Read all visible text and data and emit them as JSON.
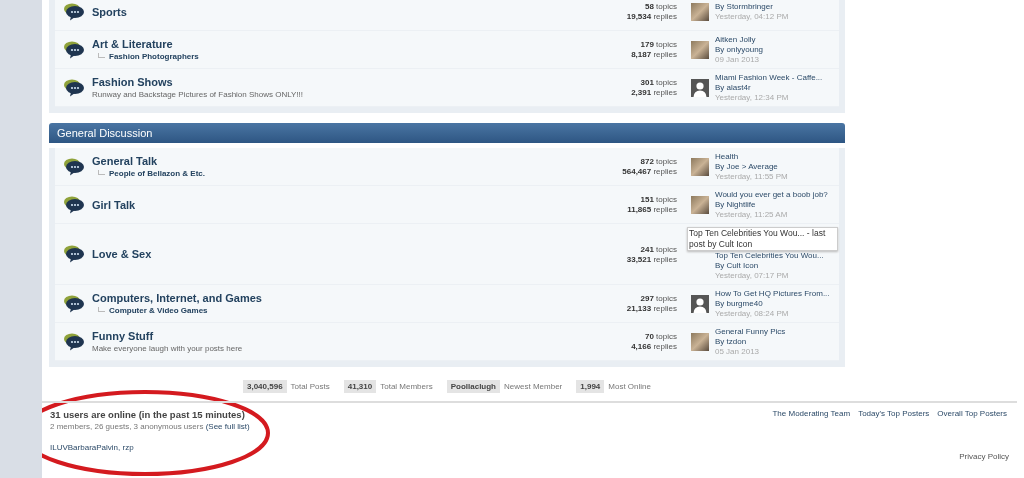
{
  "sections": [
    {
      "forums": [
        {
          "name": "Sports",
          "topics": "**58** topics",
          "replies": "**19,534** replies",
          "last_post": {
            "by": "By Stormbringer",
            "date": "Yesterday, 04:12 PM",
            "kind": "photo"
          }
        },
        {
          "name": "Art & Literature",
          "subforums": [
            "Fashion Photographers"
          ],
          "topics": "**179** topics",
          "replies": "**8,187** replies",
          "last_post": {
            "title": "Aitken Jolly",
            "by": "By onlyyoung",
            "date": "09 Jan 2013",
            "kind": "photo"
          }
        },
        {
          "name": "Fashion Shows",
          "description": "Runway and Backstage Pictures of Fashion Shows ONLY!!!",
          "topics": "**301** topics",
          "replies": "**2,391** replies",
          "last_post": {
            "title": "Miami Fashion Week - Caffe...",
            "by": "By alast4r",
            "date": "Yesterday, 12:34 PM",
            "kind": "silhouette"
          }
        }
      ]
    },
    {
      "title": "General Discussion",
      "forums": [
        {
          "name": "General Talk",
          "subforums": [
            "People of Bellazon & Etc."
          ],
          "topics": "**872** topics",
          "replies": "**564,467** replies",
          "last_post": {
            "title": "Health",
            "by": "By Joe > Average",
            "date": "Yesterday, 11:55 PM",
            "kind": "photo"
          }
        },
        {
          "name": "Girl Talk",
          "topics": "**151** topics",
          "replies": "**11,865** replies",
          "last_post": {
            "title": "Would you ever get a boob job?",
            "by": "By Nightlife",
            "date": "Yesterday, 11:25 AM",
            "kind": "photo"
          }
        },
        {
          "name": "Love & Sex",
          "topics": "**241** topics",
          "replies": "**33,521** replies",
          "tooltip": "Top Ten Celebrities You Wou... - last post by Cult Icon",
          "last_post": {
            "title": "Top Ten Celebrities You Wou...",
            "by": "By Cult Icon",
            "date": "Yesterday, 07:17 PM",
            "kind": "none"
          }
        },
        {
          "name": "Computers, Internet, and Games",
          "subforums": [
            "Computer & Video Games"
          ],
          "topics": "**297** topics",
          "replies": "**21,133** replies",
          "last_post": {
            "title": "How To Get HQ Pictures From...",
            "by": "By burgme40",
            "date": "Yesterday, 08:24 PM",
            "kind": "silhouette"
          }
        },
        {
          "name": "Funny Stuff",
          "description": "Make everyone laugh with your posts here",
          "topics": "**70** topics",
          "replies": "**4,166** replies",
          "last_post": {
            "title": "General Funny Pics",
            "by": "By tzdon",
            "date": "05 Jan 2013",
            "kind": "photo"
          }
        }
      ]
    }
  ],
  "stats": [
    {
      "value": "3,040,596",
      "label": "Total Posts"
    },
    {
      "value": "41,310",
      "label": "Total Members"
    },
    {
      "value": "Poollaclugh",
      "label": "Newest Member"
    },
    {
      "value": "1,994",
      "label": "Most Online"
    }
  ],
  "online": {
    "title": "31 users are online (in the past 15 minutes)",
    "summary": "2 members, 26 guests, 3 anonymous users",
    "full_list_link": "(See full list)",
    "members": "ILUVBarbaraPalvin, rzp"
  },
  "footer_links": [
    "The Moderating Team",
    "Today's Top Posters",
    "Overall Top Posters"
  ],
  "privacy_link": "Privacy Policy"
}
